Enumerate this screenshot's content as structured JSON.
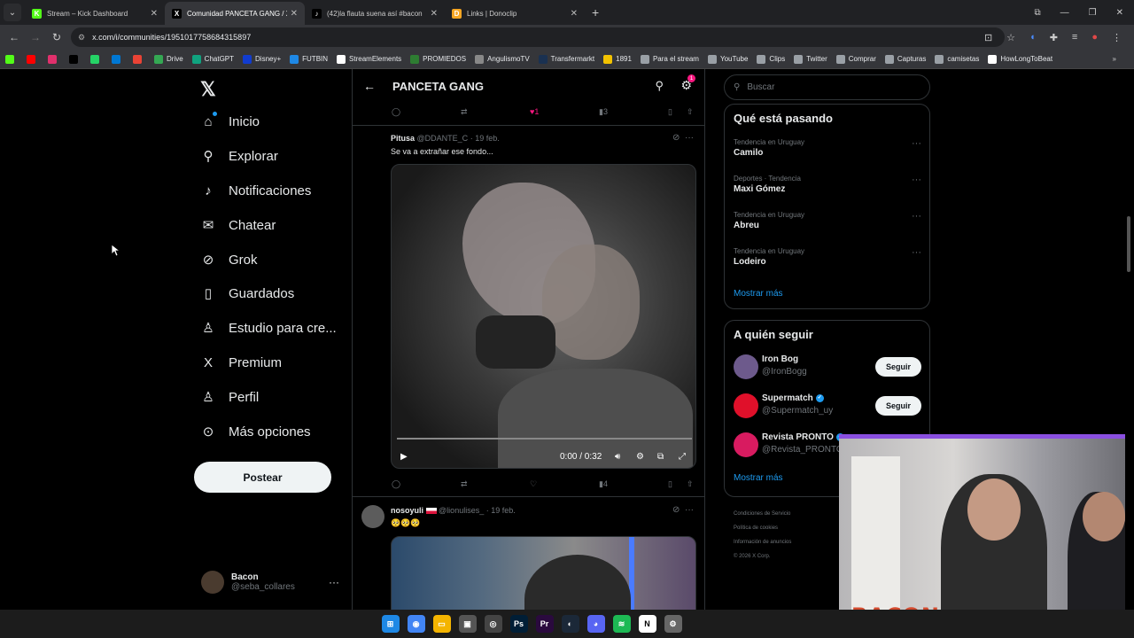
{
  "browser": {
    "tabs": [
      {
        "label": "Stream – Kick Dashboard",
        "color": "#53fc18",
        "glyph": "K"
      },
      {
        "label": "Comunidad PANCETA GANG / X",
        "color": "#000000",
        "glyph": "X"
      },
      {
        "label": "(42)la flauta suena así #bacon",
        "color": "#000000",
        "glyph": "♪"
      },
      {
        "label": "Links | Donoclip",
        "color": "#f5a623",
        "glyph": "D"
      }
    ],
    "url": "x.com/i/communities/1951017758684315897",
    "bookmarks": [
      {
        "label": "",
        "color": "#53fc18"
      },
      {
        "label": "",
        "color": "#ff0000"
      },
      {
        "label": "",
        "color": "#e1306c"
      },
      {
        "label": "",
        "color": "#000000"
      },
      {
        "label": "",
        "color": "#25d366"
      },
      {
        "label": "",
        "color": "#0078d4"
      },
      {
        "label": "",
        "color": "#ea4335"
      },
      {
        "label": "Drive",
        "color": "#34a853"
      },
      {
        "label": "ChatGPT",
        "color": "#10a37f"
      },
      {
        "label": "Disney+",
        "color": "#113ccf"
      },
      {
        "label": "FUTBIN",
        "color": "#1e88e5"
      },
      {
        "label": "StreamElements",
        "color": "#ffffff"
      },
      {
        "label": "PROMIEDOS",
        "color": "#2e7d32"
      },
      {
        "label": "AngulismoTV",
        "color": "#888888"
      },
      {
        "label": "Transfermarkt",
        "color": "#1a3151"
      },
      {
        "label": "1891",
        "color": "#f2c200"
      },
      {
        "label": "Para el stream",
        "color": "#9aa0a6"
      },
      {
        "label": "YouTube",
        "color": "#9aa0a6"
      },
      {
        "label": "Clips",
        "color": "#9aa0a6"
      },
      {
        "label": "Twitter",
        "color": "#9aa0a6"
      },
      {
        "label": "Comprar",
        "color": "#9aa0a6"
      },
      {
        "label": "Capturas",
        "color": "#9aa0a6"
      },
      {
        "label": "camisetas",
        "color": "#9aa0a6"
      },
      {
        "label": "HowLongToBeat",
        "color": "#ffffff"
      }
    ]
  },
  "sidebar": {
    "items": [
      {
        "label": "Inicio",
        "icon": "home-icon",
        "glyph": "⌂"
      },
      {
        "label": "Explorar",
        "icon": "search-icon",
        "glyph": "⚲"
      },
      {
        "label": "Notificaciones",
        "icon": "bell-icon",
        "glyph": "♪"
      },
      {
        "label": "Chatear",
        "icon": "mail-icon",
        "glyph": "✉"
      },
      {
        "label": "Grok",
        "icon": "grok-icon",
        "glyph": "⊘"
      },
      {
        "label": "Guardados",
        "icon": "bookmark-icon",
        "glyph": "▯"
      },
      {
        "label": "Estudio para cre...",
        "icon": "studio-icon",
        "glyph": "♙"
      },
      {
        "label": "Premium",
        "icon": "x-premium-icon",
        "glyph": "X"
      },
      {
        "label": "Perfil",
        "icon": "person-icon",
        "glyph": "♙"
      },
      {
        "label": "Más opciones",
        "icon": "more-circle-icon",
        "glyph": "⊙"
      }
    ],
    "post_label": "Postear",
    "account": {
      "name": "Bacon",
      "handle": "@seba_collares"
    }
  },
  "community": {
    "title": "PANCETA GANG",
    "badge_count": "1",
    "first_actions": {
      "likes": "1",
      "views": "3"
    },
    "tweet1": {
      "name": "Pitusa",
      "handle": "@DDANTE_C",
      "date": "· 19 feb.",
      "text": "Se va a extrañar ese fondo...",
      "video_time": "0:00 / 0:32",
      "views": "4"
    },
    "tweet2": {
      "name": "nosoyuli",
      "handle": "@lionulises_",
      "date": "· 19 feb.",
      "text": "🥺🥺🥺"
    }
  },
  "right": {
    "search_placeholder": "Buscar",
    "trending_title": "Qué está pasando",
    "trends": [
      {
        "context": "Tendencia en Uruguay",
        "name": "Camilo"
      },
      {
        "context": "Deportes · Tendencia",
        "name": "Maxi Gómez"
      },
      {
        "context": "Tendencia en Uruguay",
        "name": "Abreu"
      },
      {
        "context": "Tendencia en Uruguay",
        "name": "Lodeiro"
      }
    ],
    "show_more": "Mostrar más",
    "follow_title": "A quién seguir",
    "follow": [
      {
        "name": "Iron Bog",
        "handle": "@IronBogg",
        "verified": false,
        "color": "#6d5a8c"
      },
      {
        "name": "Supermatch",
        "handle": "@Supermatch_uy",
        "verified": true,
        "color": "#e0102a"
      },
      {
        "name": "Revista PRONTO",
        "handle": "@Revista_PRONTO",
        "verified": true,
        "color": "#d81b60"
      }
    ],
    "follow_button": "Seguir",
    "footer": [
      "Condiciones de Servicio",
      "Política de cookies",
      "Información de anuncios",
      "© 2026 X Corp."
    ]
  },
  "overlay": {
    "nameplate": "BACON"
  },
  "taskbar": {
    "icons": [
      {
        "name": "windows-start-icon",
        "color": "#1e88e5",
        "glyph": "⊞"
      },
      {
        "name": "chrome-icon",
        "color": "#4285f4",
        "glyph": "◉"
      },
      {
        "name": "file-explorer-icon",
        "color": "#f4b400",
        "glyph": "▭"
      },
      {
        "name": "app-icon",
        "color": "#555555",
        "glyph": "▣"
      },
      {
        "name": "obs-icon",
        "color": "#444444",
        "glyph": "◎"
      },
      {
        "name": "photoshop-icon",
        "color": "#001e36",
        "glyph": "Ps"
      },
      {
        "name": "premiere-icon",
        "color": "#2a0a3e",
        "glyph": "Pr"
      },
      {
        "name": "steam-icon",
        "color": "#1b2838",
        "glyph": "◐"
      },
      {
        "name": "discord-icon",
        "color": "#5865f2",
        "glyph": "◕"
      },
      {
        "name": "spotify-icon",
        "color": "#1db954",
        "glyph": "≋"
      },
      {
        "name": "notion-icon",
        "color": "#ffffff",
        "glyph": "N"
      },
      {
        "name": "settings-icon",
        "color": "#666666",
        "glyph": "⚙"
      }
    ]
  }
}
